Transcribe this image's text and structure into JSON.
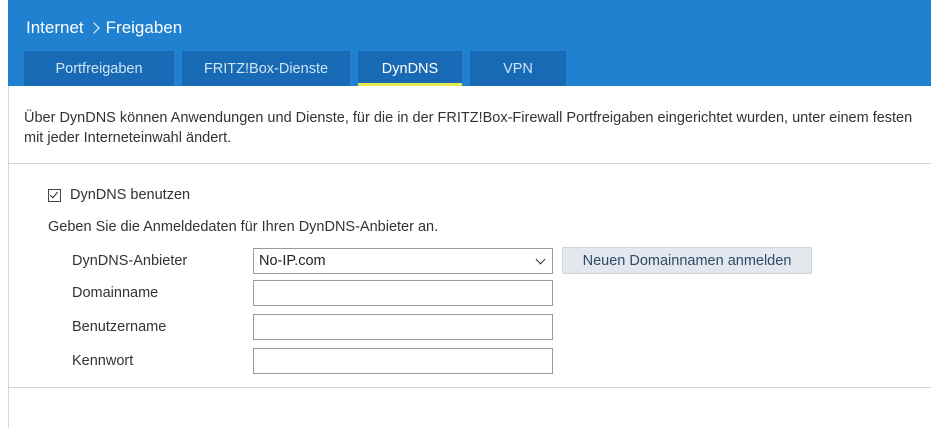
{
  "header": {
    "breadcrumb_parent": "Internet",
    "breadcrumb_current": "Freigaben"
  },
  "tabs": [
    {
      "label": "Portfreigaben",
      "active": false
    },
    {
      "label": "FRITZ!Box-Dienste",
      "active": false
    },
    {
      "label": "DynDNS",
      "active": true
    },
    {
      "label": "VPN",
      "active": false
    }
  ],
  "intro": {
    "line1": "Über DynDNS können Anwendungen und Dienste, für die in der FRITZ!Box-Firewall Portfreigaben eingerichtet wurden, unter einem festen",
    "line2": "mit jeder Interneteinwahl ändert."
  },
  "dyndns": {
    "enable_label": "DynDNS benutzen",
    "enable_checked": true,
    "hint": "Geben Sie die Anmeldedaten für Ihren DynDNS-Anbieter an.",
    "provider_label": "DynDNS-Anbieter",
    "provider_value": "No-IP.com",
    "register_button": "Neuen Domainnamen anmelden",
    "domain_label": "Domainname",
    "domain_value": "",
    "username_label": "Benutzername",
    "username_value": "",
    "password_label": "Kennwort",
    "password_value": ""
  },
  "colors": {
    "header_bg": "#1f81d0",
    "tab_bg": "#176ab3",
    "active_tab_underline": "#e4e84c"
  }
}
